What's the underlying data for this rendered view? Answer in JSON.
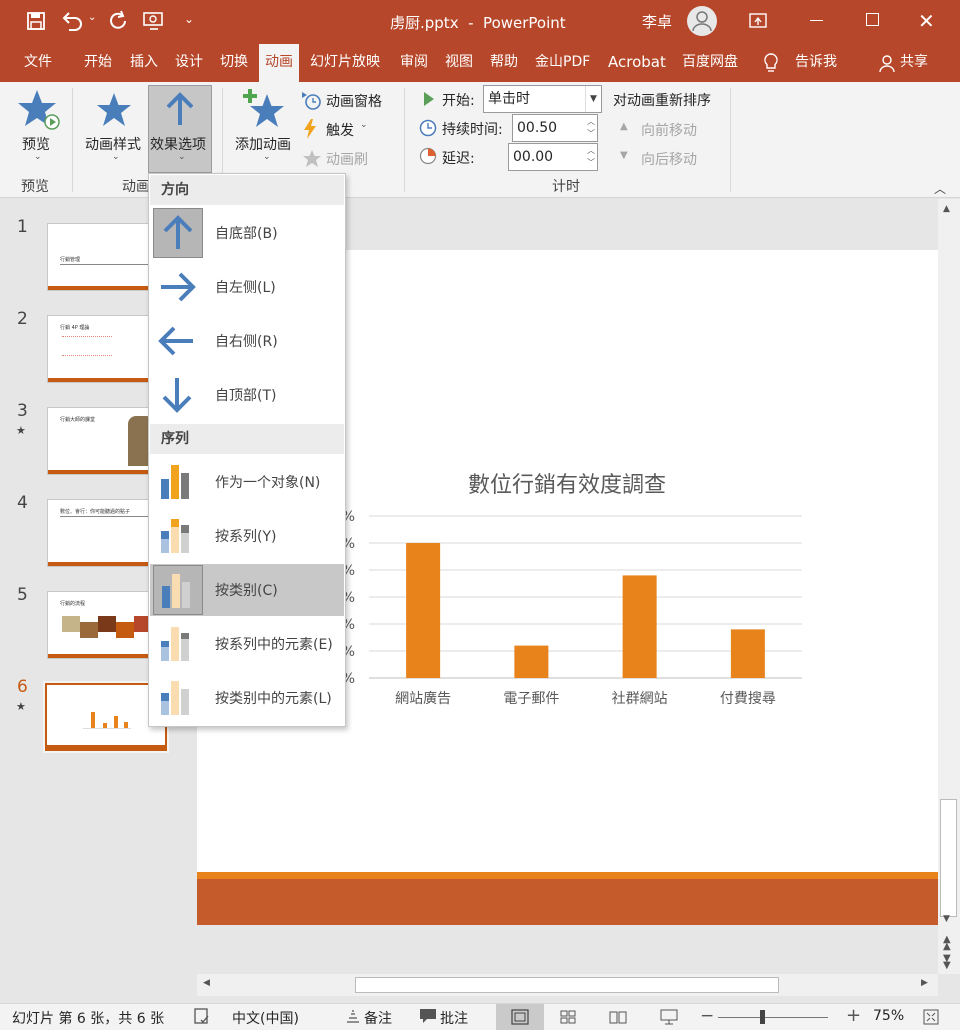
{
  "window": {
    "title": "虏厨.pptx  -  PowerPoint",
    "user": "李卓"
  },
  "tabs": [
    "文件",
    "开始",
    "插入",
    "设计",
    "切换",
    "动画",
    "幻灯片放映",
    "审阅",
    "视图",
    "帮助",
    "金山PDF",
    "Acrobat",
    "百度网盘",
    "告诉我",
    "共享"
  ],
  "ribbon": {
    "preview_label": "预览",
    "preview_group": "预览",
    "anim_style": "动画样式",
    "effect_options": "效果选项",
    "anim_group": "动画",
    "add_anim": "添加动画",
    "anim_pane": "动画窗格",
    "trigger": "触发",
    "anim_painter": "动画刷",
    "start_label": "开始:",
    "start_value": "单击时",
    "duration_label": "持续时间:",
    "duration_value": "00.50",
    "delay_label": "延迟:",
    "delay_value": "00.00",
    "timing_group": "计时",
    "reorder": "对动画重新排序",
    "move_earlier": "向前移动",
    "move_later": "向后移动"
  },
  "dropdown": {
    "direction_header": "方向",
    "directions": [
      "自底部(B)",
      "自左侧(L)",
      "自右侧(R)",
      "自顶部(T)"
    ],
    "sequence_header": "序列",
    "sequences": [
      "作为一个对象(N)",
      "按系列(Y)",
      "按类别(C)",
      "按系列中的元素(E)",
      "按类别中的元素(L)"
    ],
    "selected_direction": "自底部(B)",
    "selected_sequence": "按类别(C)"
  },
  "slides": [
    {
      "num": "1",
      "title": "行銷管理",
      "star": ""
    },
    {
      "num": "2",
      "title": "行銷 4P 理論",
      "star": ""
    },
    {
      "num": "3",
      "title": "行銷大師的課堂",
      "star": "★"
    },
    {
      "num": "4",
      "title": "數位、會行：你可能聽過的點子",
      "star": ""
    },
    {
      "num": "5",
      "title": "行銷的流程",
      "star": ""
    },
    {
      "num": "6",
      "title": "",
      "star": "★"
    }
  ],
  "chart_data": {
    "type": "bar",
    "title": "數位行銷有效度調查",
    "categories": [
      "網站廣告",
      "電子郵件",
      "社群網站",
      "付費搜尋"
    ],
    "values": [
      50,
      12,
      38,
      18
    ],
    "ylim": [
      0,
      60
    ],
    "ytick_suffix": "%",
    "color": "#e8821b",
    "grid": true
  },
  "statusbar": {
    "slide_info": "幻灯片 第 6 张，共 6 张",
    "language": "中文(中国)",
    "notes": "备注",
    "comments": "批注",
    "zoom": "75%"
  },
  "colors": {
    "brand": "#b7472a",
    "accent_blue": "#4a7ebb",
    "bar_orange": "#e8821b"
  }
}
